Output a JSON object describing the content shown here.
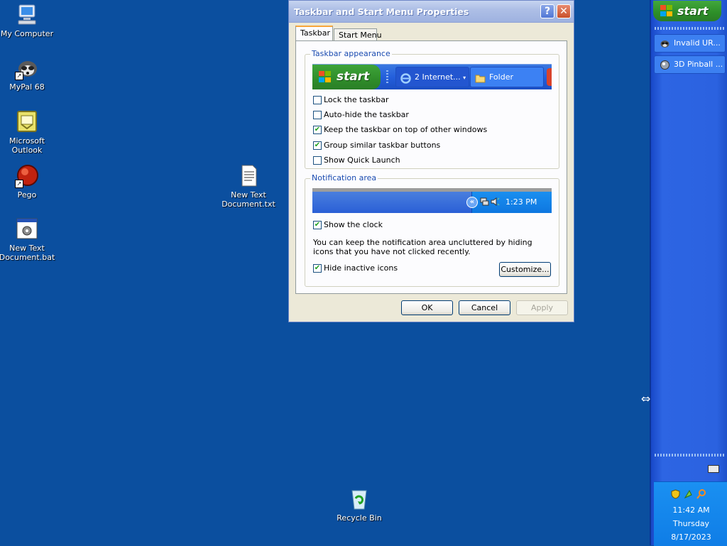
{
  "desktop": {
    "icons": [
      {
        "label": "My Computer"
      },
      {
        "label": "MyPal 68"
      },
      {
        "label": "Microsoft\nOutlook"
      },
      {
        "label": "Pego"
      },
      {
        "label": "New Text\nDocument.bat"
      },
      {
        "label": "New Text\nDocument.txt"
      },
      {
        "label": "Recycle Bin"
      }
    ]
  },
  "dialog": {
    "title": "Taskbar and Start Menu Properties",
    "help_glyph": "?",
    "close_glyph": "✕",
    "tabs": [
      {
        "label": "Taskbar",
        "active": true
      },
      {
        "label": "Start Menu",
        "active": false
      }
    ],
    "appearance": {
      "title": "Taskbar appearance",
      "preview": {
        "start_label": "start",
        "button1": "2 Internet...",
        "button2": "Folder"
      },
      "options": [
        {
          "label": "Lock the taskbar",
          "checked": false
        },
        {
          "label": "Auto-hide the taskbar",
          "checked": false
        },
        {
          "label": "Keep the taskbar on top of other windows",
          "checked": true
        },
        {
          "label": "Group similar taskbar buttons",
          "checked": true
        },
        {
          "label": "Show Quick Launch",
          "checked": false
        }
      ]
    },
    "notification": {
      "title": "Notification area",
      "preview_time": "1:23 PM",
      "show_clock": {
        "label": "Show the clock",
        "checked": true
      },
      "description": "You can keep the notification area uncluttered by hiding icons that you have not clicked recently.",
      "hide_inactive": {
        "label": "Hide inactive icons",
        "checked": true
      },
      "customize_label": "Customize..."
    },
    "buttons": {
      "ok": "OK",
      "cancel": "Cancel",
      "apply": "Apply"
    }
  },
  "taskbar": {
    "start_label": "start",
    "tasks": [
      {
        "label": "Invalid UR..."
      },
      {
        "label": "3D Pinball ..."
      }
    ],
    "clock": {
      "time": "11:42 AM",
      "day": "Thursday",
      "date": "8/17/2023"
    }
  },
  "colors": {
    "desktop": "#0b4f9f",
    "taskbar": "#2b62e0",
    "start_green": "#2f8d2a",
    "check_green": "#21a121"
  }
}
